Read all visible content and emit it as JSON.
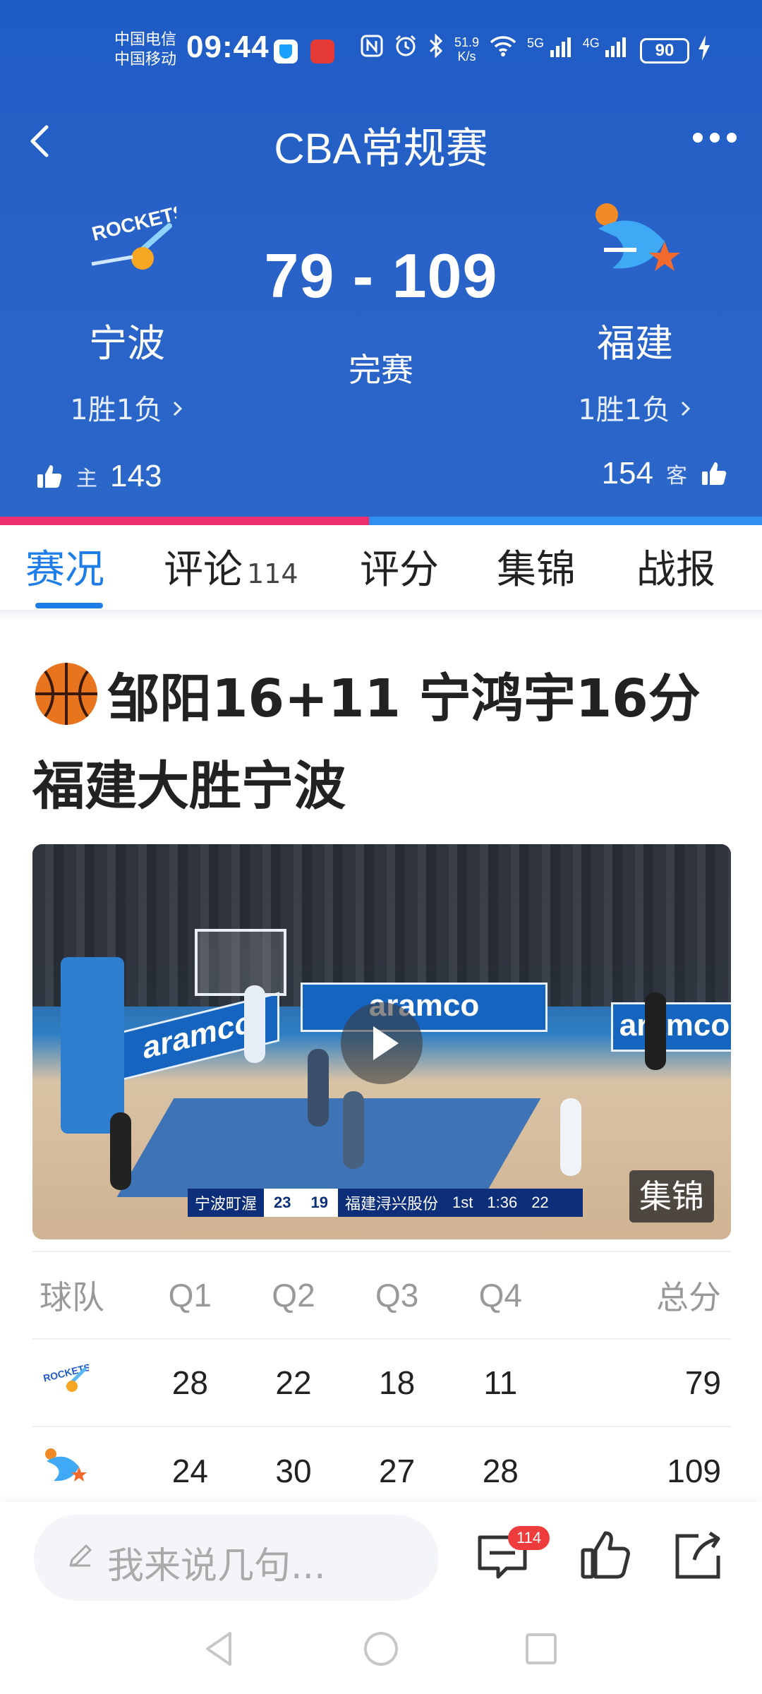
{
  "status_bar": {
    "carrier_1": "中国电信",
    "carrier_2": "中国移动",
    "time": "09:44",
    "speed_top": "51.9",
    "speed_bottom": "K/s",
    "net1": "5G",
    "net2": "4G",
    "battery": "90"
  },
  "nav": {
    "title": "CBA常规赛"
  },
  "match": {
    "home": {
      "name": "宁波",
      "record": "1胜1负",
      "likes": "143",
      "side_tag": "主"
    },
    "away": {
      "name": "福建",
      "record": "1胜1负",
      "likes": "154",
      "side_tag": "客"
    },
    "score": "79 - 109",
    "status": "完赛",
    "home_vote_fraction": 0.484
  },
  "tabs": [
    {
      "label": "赛况",
      "active": true
    },
    {
      "label": "评论",
      "count": "114"
    },
    {
      "label": "评分"
    },
    {
      "label": "集锦"
    },
    {
      "label": "战报"
    }
  ],
  "article": {
    "headline": "邹阳16+11 宁鸿宇16分 福建大胜宁波",
    "video_tag": "集锦",
    "scorebug": {
      "home": "宁波町渥",
      "home_score": "23",
      "away_score": "19",
      "away": "福建浔兴股份",
      "quarter": "1st",
      "clock": "1:36",
      "shot": "22"
    },
    "banner_text": "aramco"
  },
  "score_table": {
    "headers": [
      "球队",
      "Q1",
      "Q2",
      "Q3",
      "Q4",
      "总分"
    ],
    "rows": [
      {
        "team": "宁波",
        "values": [
          "28",
          "22",
          "18",
          "11",
          "79"
        ]
      },
      {
        "team": "福建",
        "values": [
          "24",
          "30",
          "27",
          "28",
          "109"
        ]
      }
    ]
  },
  "bottom": {
    "comment_placeholder": "我来说几句...",
    "comment_badge": "114"
  },
  "colors": {
    "header_blue": "#2a63c8",
    "active_tab": "#1f7de8",
    "home_bar": "#ee2f6d",
    "away_bar": "#2f8ff0",
    "badge_red": "#ee3b3b"
  }
}
